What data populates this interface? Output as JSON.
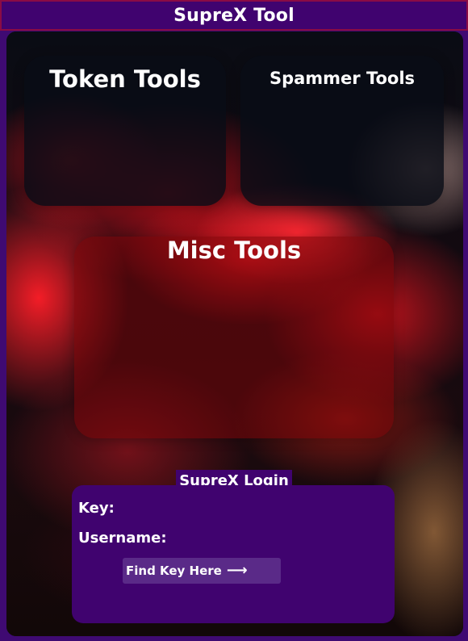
{
  "window": {
    "title": "SupreX Tool"
  },
  "panels": {
    "token": {
      "label": "Token Tools"
    },
    "spammer": {
      "label": "Spammer Tools"
    },
    "misc": {
      "label": "Misc Tools"
    }
  },
  "login": {
    "title": "SupreX Login",
    "key_label": "Key:",
    "username_label": "Username:",
    "find_key_label": "Find Key Here",
    "find_key_icon": "arrow-right-icon"
  },
  "colors": {
    "title_bg": "#40036f",
    "title_border": "#8a0c45",
    "login_bg": "#40036f",
    "button_bg": "#5a2a88",
    "accent_red": "#e0141e"
  }
}
